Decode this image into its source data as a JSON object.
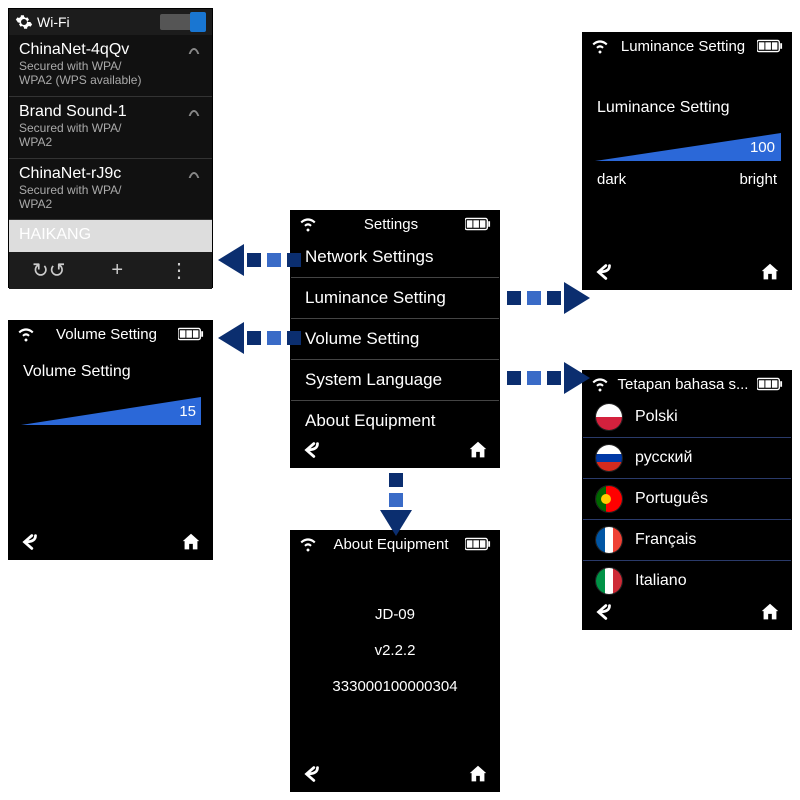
{
  "wifi": {
    "header": "Wi-Fi",
    "toggle": true,
    "networks": [
      {
        "name": "ChinaNet-4qQv",
        "security": "Secured with WPA/\nWPA2 (WPS available)"
      },
      {
        "name": "Brand Sound-1",
        "security": "Secured with WPA/\nWPA2"
      },
      {
        "name": "ChinaNet-rJ9c",
        "security": "Secured with WPA/\nWPA2"
      },
      {
        "name": "HAIKANG",
        "security": ""
      }
    ]
  },
  "settings": {
    "title": "Settings",
    "items": [
      "Network Settings",
      "Luminance Setting",
      "Volume Setting",
      "System Language",
      "About Equipment"
    ]
  },
  "volume": {
    "header": "Volume Setting",
    "label": "Volume Setting",
    "value": "15"
  },
  "luminance": {
    "header": "Luminance Setting",
    "label": "Luminance Setting",
    "value": "100",
    "min_label": "dark",
    "max_label": "bright"
  },
  "language": {
    "header": "Tetapan bahasa s...",
    "items": [
      {
        "name": "Polski",
        "flag": "pl"
      },
      {
        "name": "русский",
        "flag": "ru"
      },
      {
        "name": "Português",
        "flag": "pt"
      },
      {
        "name": "Français",
        "flag": "fr"
      },
      {
        "name": "Italiano",
        "flag": "it"
      }
    ]
  },
  "about": {
    "header": "About Equipment",
    "model": "JD-09",
    "version": "v2.2.2",
    "serial": "333000100000304"
  }
}
